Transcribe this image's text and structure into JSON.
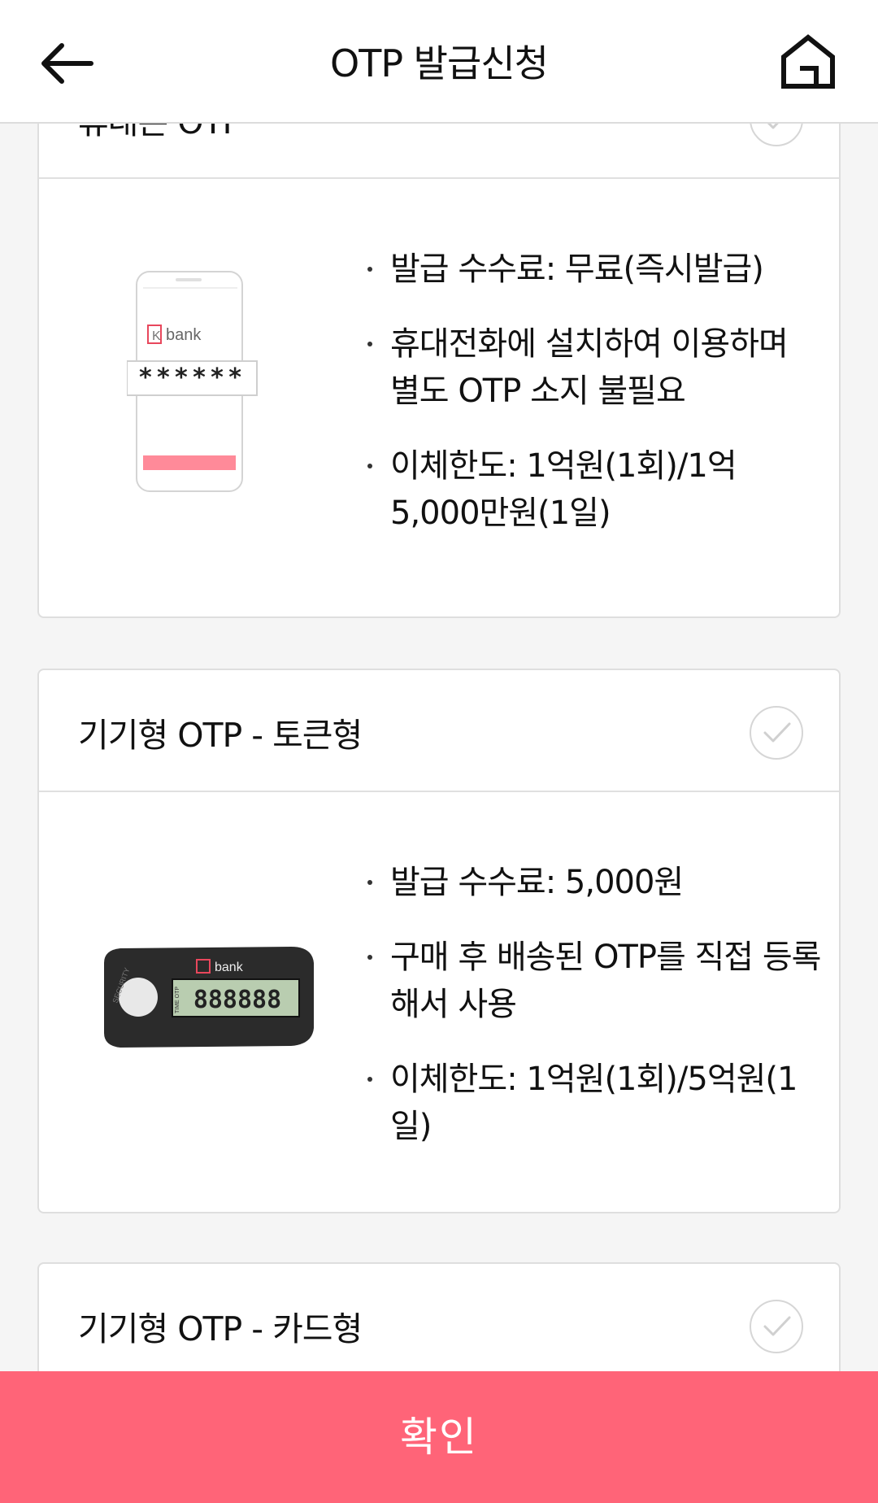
{
  "header": {
    "title": "OTP 발급신청"
  },
  "cards": [
    {
      "title": "휴대폰 OTP",
      "bullets": [
        "발급 수수료: 무료(즉시발급)",
        "휴대전화에 설치하여 이용하며 별도 OTP 소지 불필요",
        "이체한도: 1억원(1회)/1억 5,000만원(1일)"
      ],
      "illus_brand": "bank",
      "illus_code": "******"
    },
    {
      "title": "기기형 OTP - 토큰형",
      "bullets": [
        "발급 수수료: 5,000원",
        "구매 후 배송된 OTP를 직접 등록해서 사용",
        "이체한도: 1억원(1회)/5억원(1일)"
      ],
      "illus_brand": "bank",
      "illus_code": "888888",
      "illus_side": "SECURITY",
      "illus_tag": "TIME OTP"
    },
    {
      "title": "기기형 OTP - 카드형"
    }
  ],
  "confirm_label": "확인",
  "colors": {
    "accent": "#ff6478",
    "logo": "#e8475c"
  }
}
